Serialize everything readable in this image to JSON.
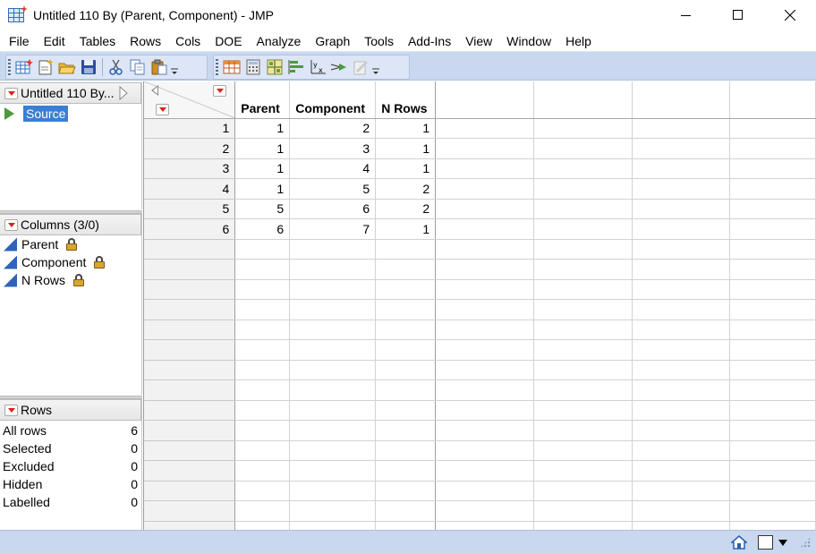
{
  "window": {
    "title": "Untitled 110 By (Parent, Component) - JMP"
  },
  "menu": [
    "File",
    "Edit",
    "Tables",
    "Rows",
    "Cols",
    "DOE",
    "Analyze",
    "Graph",
    "Tools",
    "Add-Ins",
    "View",
    "Window",
    "Help"
  ],
  "table_panel": {
    "title": "Untitled 110 By...",
    "source_label": "Source"
  },
  "columns_panel": {
    "title": "Columns (3/0)",
    "items": [
      "Parent",
      "Component",
      "N Rows"
    ]
  },
  "rows_panel": {
    "title": "Rows",
    "items": [
      {
        "label": "All rows",
        "value": "6"
      },
      {
        "label": "Selected",
        "value": "0"
      },
      {
        "label": "Excluded",
        "value": "0"
      },
      {
        "label": "Hidden",
        "value": "0"
      },
      {
        "label": "Labelled",
        "value": "0"
      }
    ]
  },
  "data_table": {
    "headers": [
      "Parent",
      "Component",
      "N Rows"
    ],
    "rows": [
      {
        "n": "1",
        "cells": [
          "1",
          "2",
          "1"
        ]
      },
      {
        "n": "2",
        "cells": [
          "1",
          "3",
          "1"
        ]
      },
      {
        "n": "3",
        "cells": [
          "1",
          "4",
          "1"
        ]
      },
      {
        "n": "4",
        "cells": [
          "1",
          "5",
          "2"
        ]
      },
      {
        "n": "5",
        "cells": [
          "5",
          "6",
          "2"
        ]
      },
      {
        "n": "6",
        "cells": [
          "6",
          "7",
          "1"
        ]
      }
    ]
  },
  "colors": {
    "toolbar_bg": "#c9d7ef",
    "selection": "#3a7fd6",
    "red_triangle": "#d6231c",
    "continuous_icon": "#2d63b8"
  }
}
